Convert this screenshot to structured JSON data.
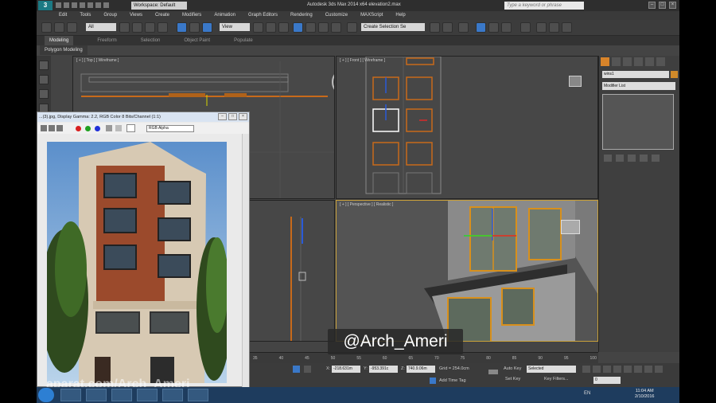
{
  "titlebar": {
    "workspace": "Workspace: Default",
    "app_title": "Autodesk 3ds Max 2014 x64     elevation2.max",
    "search_placeholder": "Type a keyword or phrase"
  },
  "menus": [
    "Edit",
    "Tools",
    "Group",
    "Views",
    "Create",
    "Modifiers",
    "Animation",
    "Graph Editors",
    "Rendering",
    "Customize",
    "MAXScript",
    "Help"
  ],
  "toolbar": {
    "filter_value": "All",
    "ref_coord_value": "View",
    "selection_set_value": "Create Selection Se"
  },
  "ribbon": {
    "tabs": [
      "Modeling",
      "Freeform",
      "Selection",
      "Object Paint",
      "Populate"
    ],
    "active_tab": "Modeling",
    "panel": "Polygon Modeling"
  },
  "viewports": {
    "top": "[ + ] [ Top ] [ Wireframe ]",
    "front": "[ + ] [ Front ] [ Wireframe ]",
    "perspective": "[ + ] [ Perspective ] [ Realistic ]"
  },
  "command_panel": {
    "object_name": "wins1",
    "modifier_list": "Modifier List",
    "swatch_color": "#d08a2a"
  },
  "timeline": {
    "ticks": [
      "35",
      "40",
      "45",
      "50",
      "55",
      "60",
      "65",
      "70",
      "75",
      "80",
      "85",
      "90",
      "95",
      "100"
    ]
  },
  "statusbar": {
    "x_label": "X:",
    "x_value": "-218.631m",
    "y_label": "Y:",
    "y_value": "-953.391c",
    "z_label": "Z:",
    "z_value": "740.9.06m",
    "grid": "Grid = 254.0cm",
    "add_time_tag": "Add Time Tag",
    "auto_key": "Auto Key",
    "set_key": "Set Key",
    "selected": "Selected",
    "key_filters": "Key Filters...",
    "frame": "0"
  },
  "image_window": {
    "title": "...(3).jpg, Display Gamma: 2.2, RGB Color 8 Bits/Channel (1:1)",
    "channel": "RGB Alpha"
  },
  "watermark": "@Arch_Ameri",
  "aparat_watermark": "aparat.com/Arch_Ameri",
  "taskbar": {
    "language": "EN",
    "time": "11:04 AM",
    "date": "2/10/2016"
  }
}
